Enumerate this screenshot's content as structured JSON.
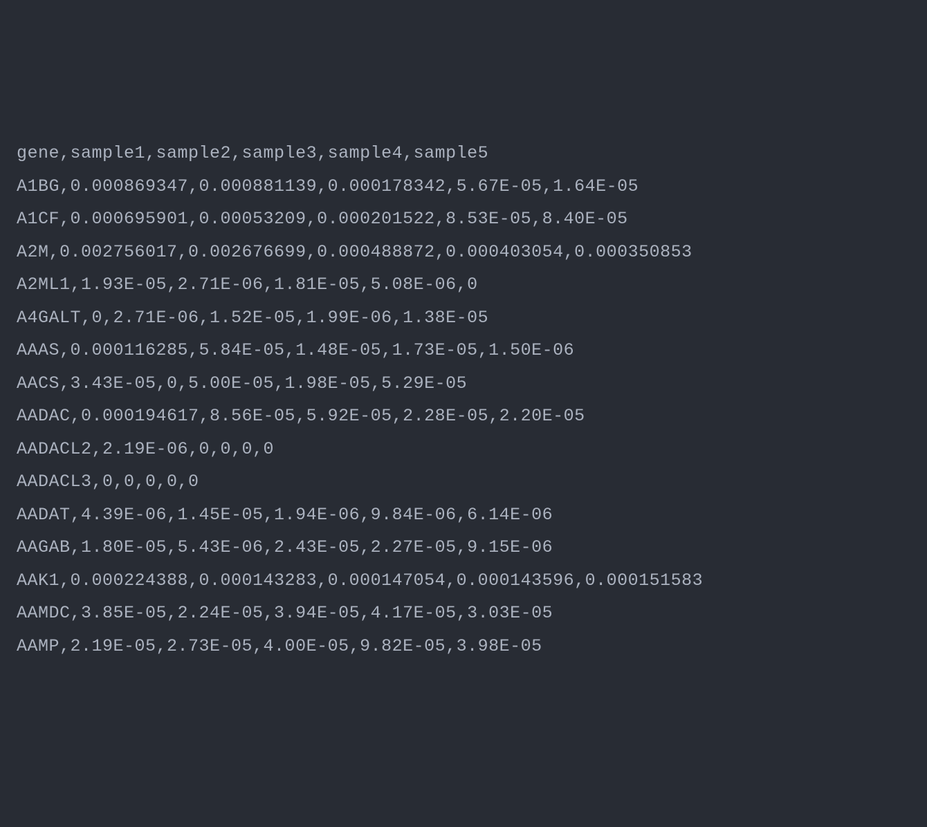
{
  "csv": {
    "header": "gene,sample1,sample2,sample3,sample4,sample5",
    "rows": [
      "A1BG,0.000869347,0.000881139,0.000178342,5.67E-05,1.64E-05",
      "A1CF,0.000695901,0.00053209,0.000201522,8.53E-05,8.40E-05",
      "A2M,0.002756017,0.002676699,0.000488872,0.000403054,0.000350853",
      "A2ML1,1.93E-05,2.71E-06,1.81E-05,5.08E-06,0",
      "A4GALT,0,2.71E-06,1.52E-05,1.99E-06,1.38E-05",
      "AAAS,0.000116285,5.84E-05,1.48E-05,1.73E-05,1.50E-06",
      "AACS,3.43E-05,0,5.00E-05,1.98E-05,5.29E-05",
      "AADAC,0.000194617,8.56E-05,5.92E-05,2.28E-05,2.20E-05",
      "AADACL2,2.19E-06,0,0,0,0",
      "AADACL3,0,0,0,0,0",
      "AADAT,4.39E-06,1.45E-05,1.94E-06,9.84E-06,6.14E-06",
      "AAGAB,1.80E-05,5.43E-06,2.43E-05,2.27E-05,9.15E-06",
      "AAK1,0.000224388,0.000143283,0.000147054,0.000143596,0.000151583",
      "AAMDC,3.85E-05,2.24E-05,3.94E-05,4.17E-05,3.03E-05",
      "AAMP,2.19E-05,2.73E-05,4.00E-05,9.82E-05,3.98E-05"
    ]
  }
}
